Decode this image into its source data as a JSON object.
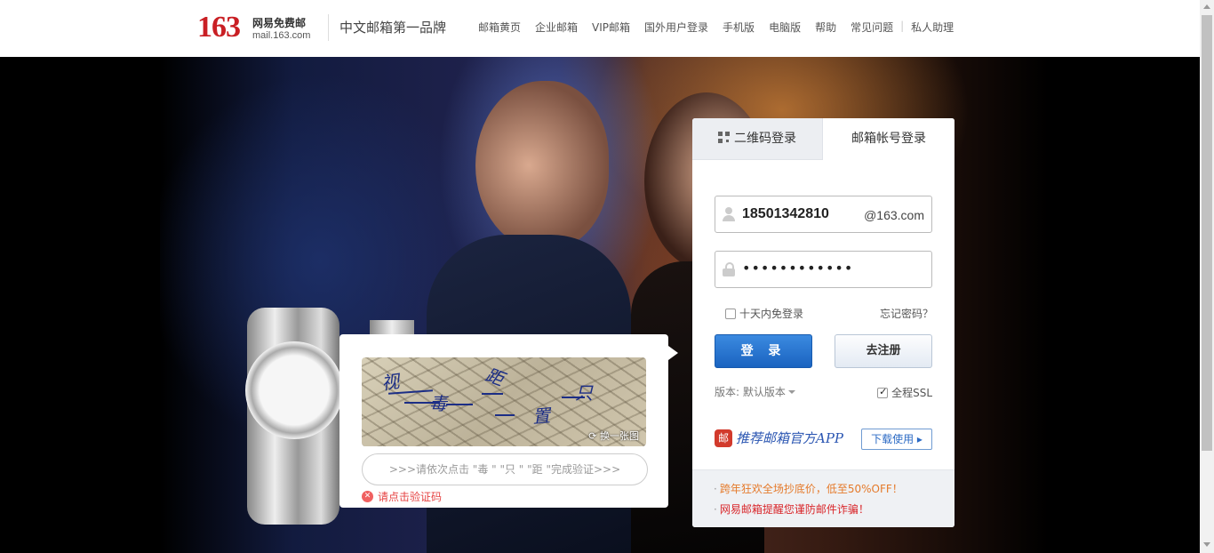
{
  "header": {
    "logo_number": "163",
    "logo_cn": "网易免费邮",
    "logo_url": "mail.163.com",
    "slogan": "中文邮箱第一品牌",
    "nav": [
      "邮箱黄页",
      "企业邮箱",
      "VIP邮箱",
      "国外用户登录",
      "手机版",
      "电脑版",
      "帮助",
      "常见问题",
      "私人助理"
    ]
  },
  "captcha": {
    "chars": [
      "视",
      "毒",
      "距",
      "只",
      "置"
    ],
    "refresh_label": "换一张图",
    "instruction": ">>>请依次点击 \"毒 \" \"只 \" \"距 \"完成验证>>>",
    "error": "请点击验证码",
    "error_icon": "close-icon"
  },
  "login": {
    "tabs": [
      {
        "label": "二维码登录",
        "icon": "qr-code-icon"
      },
      {
        "label": "邮箱帐号登录"
      }
    ],
    "username": "18501342810",
    "domain_suffix": "@163.com",
    "password_masked": "••••••••••••",
    "remember_label": "十天内免登录",
    "remember_checked": false,
    "forgot_label": "忘记密码？",
    "login_button": "登 录",
    "register_button": "去注册",
    "version_label": "版本: 默认版本",
    "ssl_label": "全程SSL",
    "ssl_checked": true,
    "app_logo_char": "邮",
    "app_promo": "推荐邮箱官方APP",
    "download_button": "下载使用 ▸",
    "promos": [
      "跨年狂欢全场抄底价，低至50%OFF！",
      "网易邮箱提醒您谨防邮件诈骗！"
    ]
  },
  "colors": {
    "brand_red": "#c91f24",
    "login_blue": "#1a63c0",
    "promo_orange": "#e57a2b",
    "promo_red": "#d9262a"
  }
}
